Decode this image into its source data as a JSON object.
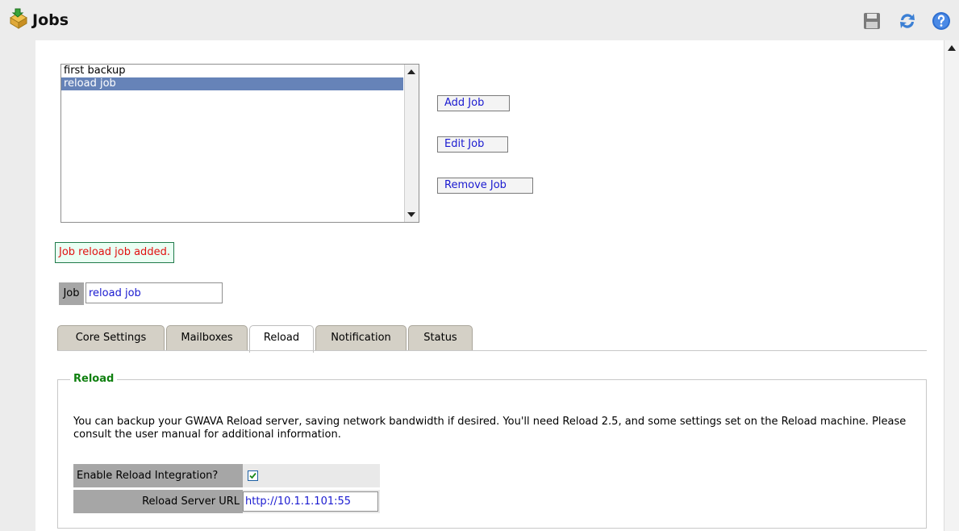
{
  "header": {
    "title": "Jobs",
    "icons": [
      "jobs-icon",
      "save-icon",
      "refresh-icon",
      "help-icon"
    ]
  },
  "jobs_list": {
    "items": [
      "first backup",
      "reload job"
    ],
    "selected": "reload job"
  },
  "buttons": {
    "add": "Add Job",
    "edit": "Edit Job",
    "remove": "Remove Job"
  },
  "message": "Job reload job added.",
  "job_field": {
    "label": "Job",
    "value": "reload job"
  },
  "tabs": [
    "Core Settings",
    "Mailboxes",
    "Reload",
    "Notification",
    "Status"
  ],
  "active_tab": "Reload",
  "reload": {
    "legend": "Reload",
    "description": "You can backup your GWAVA Reload server, saving network bandwidth if desired. You'll need Reload 2.5, and some settings set on the Reload machine. Please consult the user manual for additional information.",
    "enable_label": "Enable Reload Integration?",
    "enable_checked": true,
    "url_label": "Reload Server URL",
    "url_value": "http://10.1.1.101:55"
  },
  "colors": {
    "selection": "#6683b8",
    "legend": "#108010",
    "message_text": "#e01010",
    "link_text": "#1a1ad0"
  }
}
